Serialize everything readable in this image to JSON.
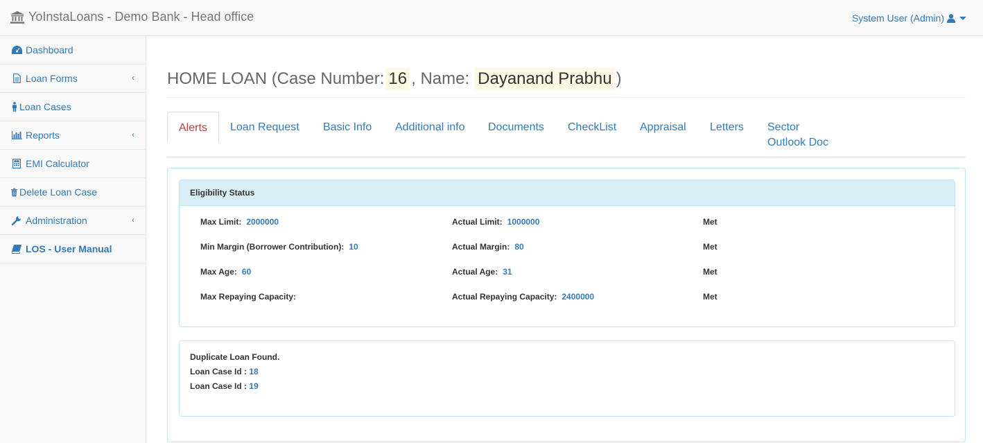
{
  "navbar": {
    "brand": "YoInstaLoans - Demo Bank - Head office",
    "user_label": "System User (Admin)"
  },
  "sidebar": {
    "items": [
      {
        "label": "Dashboard",
        "icon": "dashboard-icon"
      },
      {
        "label": "Loan Forms",
        "icon": "file-icon"
      },
      {
        "label": "Loan Cases",
        "icon": "person-icon"
      },
      {
        "label": "Reports",
        "icon": "bar-chart-icon"
      },
      {
        "label": "EMI Calculator",
        "icon": "calculator-icon"
      },
      {
        "label": "Delete Loan Case",
        "icon": "trash-icon"
      },
      {
        "label": "Administration",
        "icon": "wrench-icon"
      },
      {
        "label": "LOS - User Manual",
        "icon": "book-icon"
      }
    ]
  },
  "page": {
    "title_prefix": "HOME LOAN (Case Number:",
    "case_number": "16",
    "title_mid": ", Name:",
    "name": "Dayanand Prabhu",
    "title_suffix": ")"
  },
  "tabs": [
    {
      "label": "Alerts"
    },
    {
      "label": "Loan Request"
    },
    {
      "label": "Basic Info"
    },
    {
      "label": "Additional info"
    },
    {
      "label": "Documents"
    },
    {
      "label": "CheckList"
    },
    {
      "label": "Appraisal"
    },
    {
      "label": "Letters"
    },
    {
      "label": "Sector Outlook Doc"
    }
  ],
  "eligibility": {
    "heading": "Eligibility Status",
    "rows": [
      {
        "label1": "Max Limit:",
        "val1": "2000000",
        "label2": "Actual Limit:",
        "val2": "1000000",
        "status": "Met"
      },
      {
        "label1": "Min Margin (Borrower Contribution):",
        "val1": "10",
        "label2": "Actual Margin:",
        "val2": "80",
        "status": "Met"
      },
      {
        "label1": "Max Age:",
        "val1": "60",
        "label2": "Actual Age:",
        "val2": "31",
        "status": "Met"
      },
      {
        "label1": "Max Repaying Capacity:",
        "val1": "",
        "label2": "Actual Repaying Capacity:",
        "val2": "2400000",
        "status": "Met"
      }
    ]
  },
  "duplicate": {
    "message": "Duplicate Loan Found.",
    "id_label": "Loan Case Id :",
    "ids": [
      "18",
      "19"
    ]
  },
  "colors": {
    "link": "#337ab7",
    "active_tab": "#a94442",
    "panel_head": "#d9edf7",
    "highlight": "#fcf8e3"
  }
}
